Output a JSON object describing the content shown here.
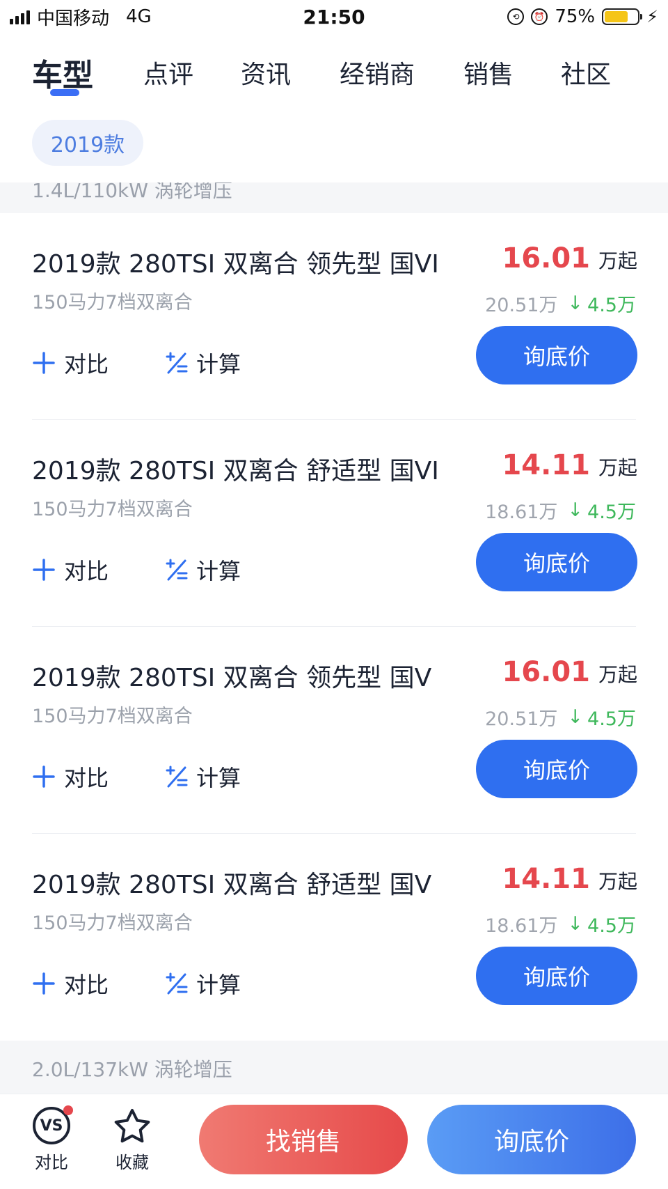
{
  "status_bar": {
    "carrier": "中国移动",
    "network": "4G",
    "time": "21:50",
    "battery_pct": "75%"
  },
  "tabs": [
    {
      "label": "车型",
      "active": true
    },
    {
      "label": "点评"
    },
    {
      "label": "资讯"
    },
    {
      "label": "经销商"
    },
    {
      "label": "销售"
    },
    {
      "label": "社区"
    }
  ],
  "year_filter": "2019款",
  "sections": {
    "top_partial": "1.4L/110kW 涡轮增压",
    "bottom": "2.0L/137kW 涡轮增压"
  },
  "actions": {
    "compare": "对比",
    "calc": "计算",
    "ask": "询底价"
  },
  "cars": [
    {
      "title": "2019款 280TSI 双离合 领先型 国VI",
      "spec": "150马力7档双离合",
      "price": "16.01",
      "price_unit": "万起",
      "original": "20.51万",
      "drop": "4.5万"
    },
    {
      "title": "2019款 280TSI 双离合 舒适型 国VI",
      "spec": "150马力7档双离合",
      "price": "14.11",
      "price_unit": "万起",
      "original": "18.61万",
      "drop": "4.5万"
    },
    {
      "title": "2019款 280TSI 双离合 领先型 国V",
      "spec": "150马力7档双离合",
      "price": "16.01",
      "price_unit": "万起",
      "original": "20.51万",
      "drop": "4.5万"
    },
    {
      "title": "2019款 280TSI 双离合 舒适型 国V",
      "spec": "150马力7档双离合",
      "price": "14.11",
      "price_unit": "万起",
      "original": "18.61万",
      "drop": "4.5万"
    }
  ],
  "bottom_bar": {
    "compare_label": "对比",
    "compare_icon_text": "VS",
    "favorite_label": "收藏",
    "find_sales": "找销售",
    "ask_price": "询底价"
  },
  "colors": {
    "accent_blue": "#2f6ff0",
    "price_red": "#e5474d",
    "drop_green": "#3fb85c"
  }
}
